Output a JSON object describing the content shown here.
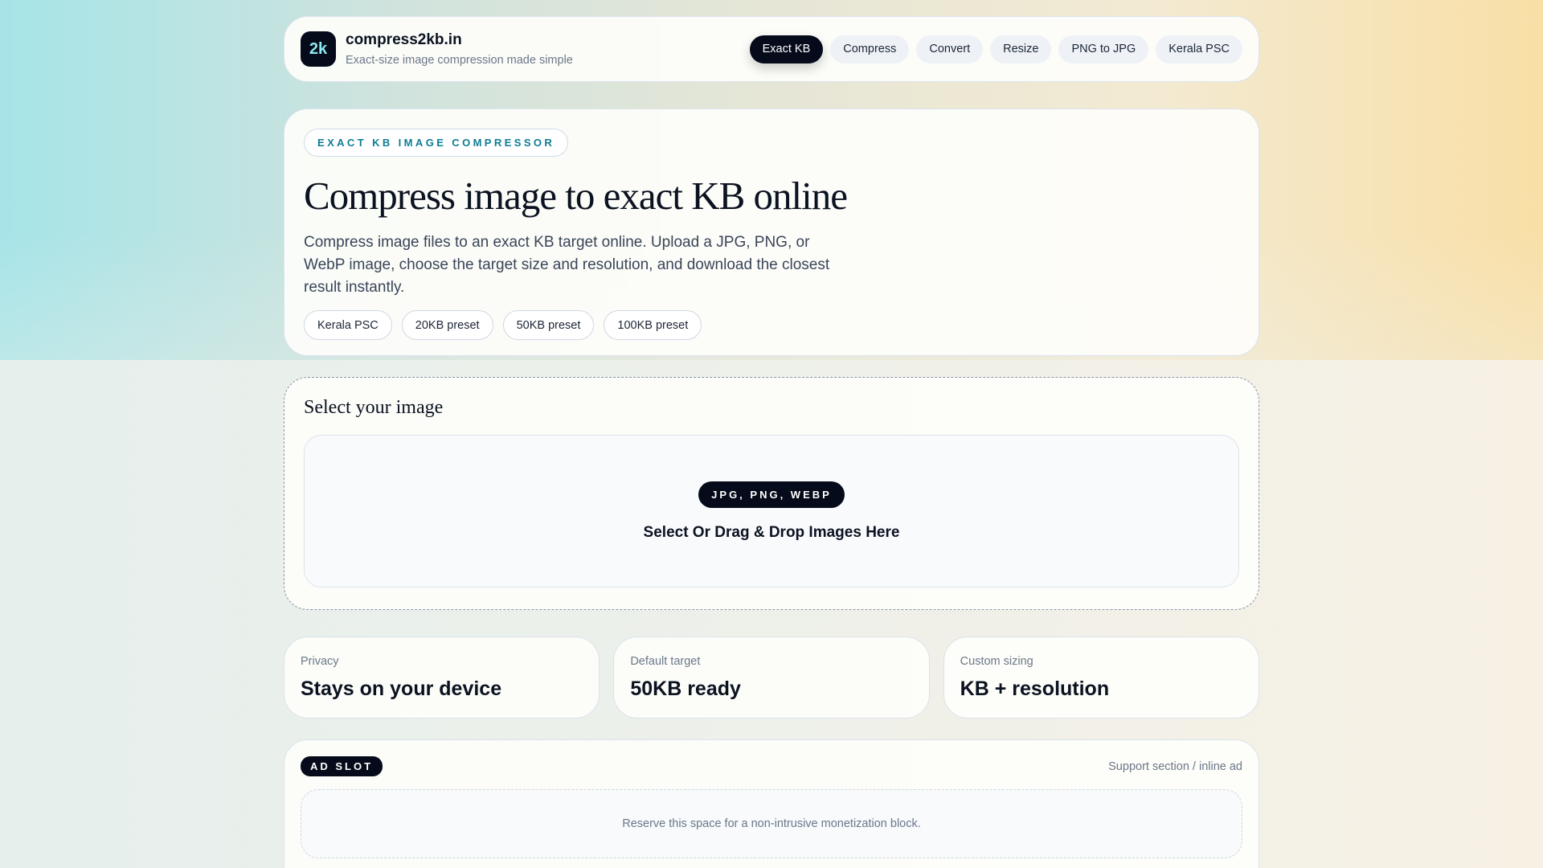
{
  "header": {
    "logo": "2k",
    "title": "compress2kb.in",
    "subtitle": "Exact-size image compression made simple",
    "nav": [
      "Exact KB",
      "Compress",
      "Convert",
      "Resize",
      "PNG to JPG",
      "Kerala PSC"
    ]
  },
  "hero": {
    "eyebrow": "EXACT KB IMAGE COMPRESSOR",
    "title": "Compress image to exact KB online",
    "description": "Compress image files to an exact KB target online. Upload a JPG, PNG, or WebP image, choose the target size and resolution, and download the closest result instantly.",
    "presets": [
      "Kerala PSC",
      "20KB preset",
      "50KB preset",
      "100KB preset"
    ]
  },
  "upload": {
    "title": "Select your image",
    "formats": "JPG, PNG, WEBP",
    "prompt": "Select Or Drag & Drop Images Here"
  },
  "features": [
    {
      "label": "Privacy",
      "value": "Stays on your device"
    },
    {
      "label": "Default target",
      "value": "50KB ready"
    },
    {
      "label": "Custom sizing",
      "value": "KB + resolution"
    }
  ],
  "ad": {
    "badge": "AD SLOT",
    "note": "Support section / inline ad",
    "placeholder": "Reserve this space for a non-intrusive monetization block."
  }
}
